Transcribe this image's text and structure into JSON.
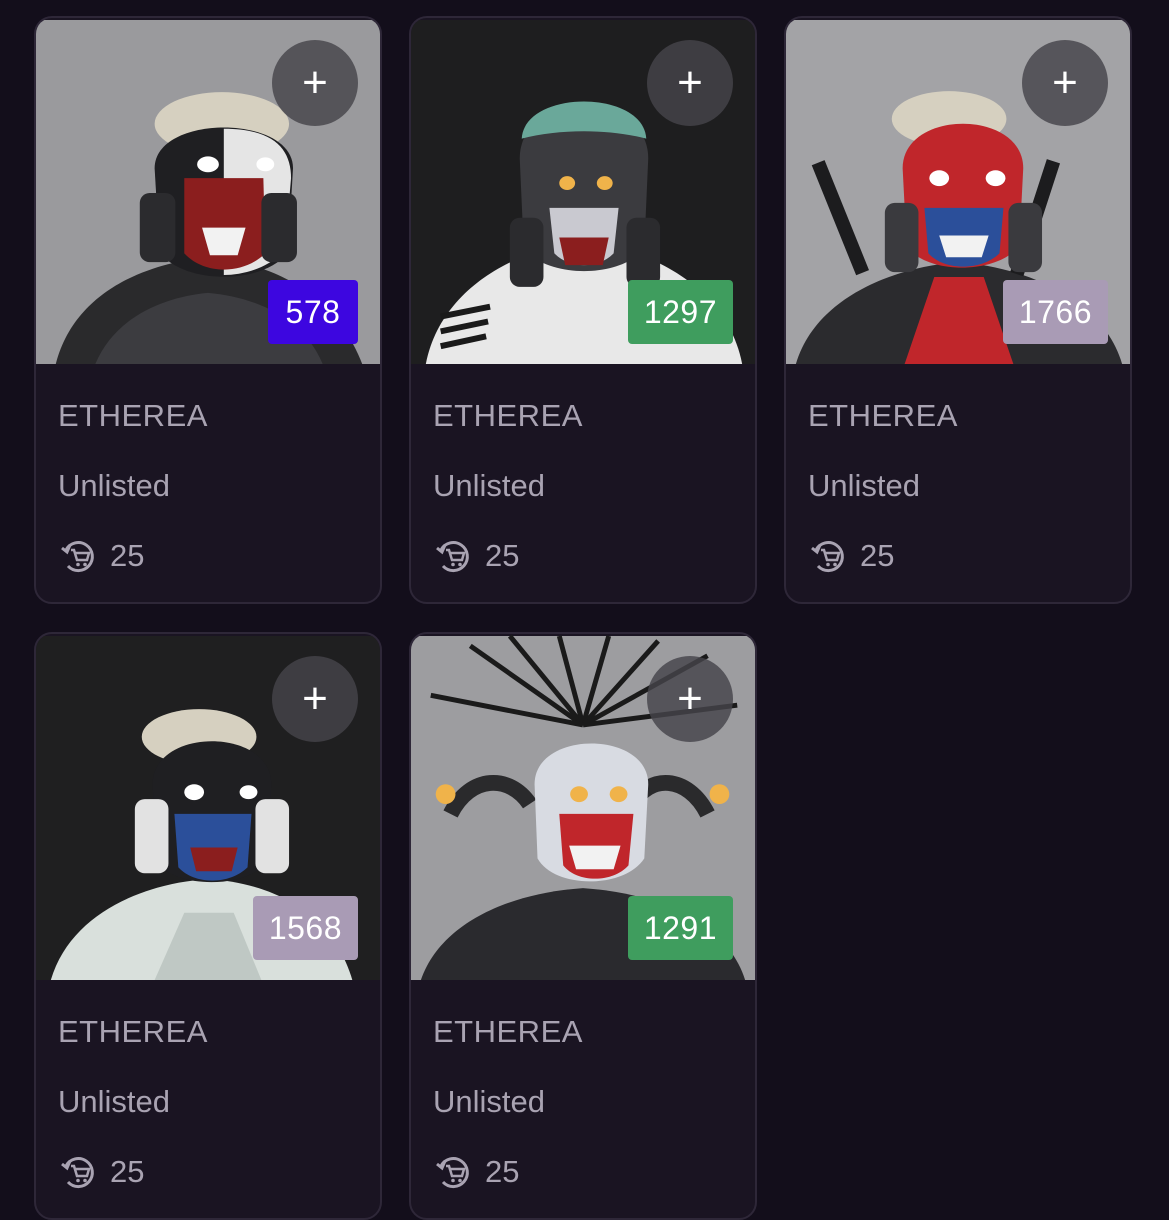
{
  "colors": {
    "page_bg": "#130e1b",
    "card_bg": "#1a1422",
    "text_muted": "#a9a3b2",
    "add_button_bg": "#46444a"
  },
  "add_icon": "plus-icon",
  "supply_icon": "cart-refresh-icon",
  "cards": [
    {
      "rank": "578",
      "rank_color": "#3d06e0",
      "collection": "ETHEREA",
      "status": "Unlisted",
      "supply": "25",
      "art_bg": "#9a9a9d",
      "art_accent": "#8b1e1e"
    },
    {
      "rank": "1297",
      "rank_color": "#3f9d5e",
      "collection": "ETHEREA",
      "status": "Unlisted",
      "supply": "25",
      "art_bg": "#1e1e1f",
      "art_accent": "#6aa89a"
    },
    {
      "rank": "1766",
      "rank_color": "#a99bb5",
      "collection": "ETHEREA",
      "status": "Unlisted",
      "supply": "25",
      "art_bg": "#a3a3a6",
      "art_accent": "#c0262b"
    },
    {
      "rank": "1568",
      "rank_color": "#a99bb5",
      "collection": "ETHEREA",
      "status": "Unlisted",
      "supply": "25",
      "art_bg": "#1f1f20",
      "art_accent": "#2b4f9a"
    },
    {
      "rank": "1291",
      "rank_color": "#3f9d5e",
      "collection": "ETHEREA",
      "status": "Unlisted",
      "supply": "25",
      "art_bg": "#9d9da0",
      "art_accent": "#c0262b"
    }
  ]
}
